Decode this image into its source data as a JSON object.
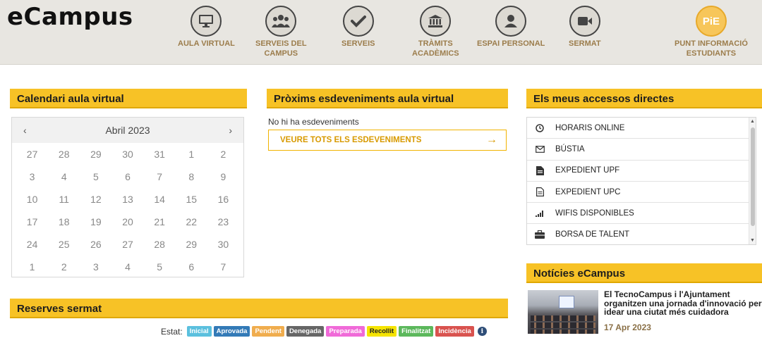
{
  "header": {
    "logo": "eCampus",
    "nav": [
      {
        "label": "AULA VIRTUAL",
        "icon": "monitor-icon"
      },
      {
        "label": "SERVEIS DEL\nCAMPUS",
        "icon": "group-icon"
      },
      {
        "label": "SERVEIS",
        "icon": "check-icon"
      },
      {
        "label": "TRÀMITS\nACADÈMICS",
        "icon": "institution-icon"
      },
      {
        "label": "ESPAI PERSONAL",
        "icon": "user-icon"
      },
      {
        "label": "SERMAT",
        "icon": "video-camera-icon"
      },
      {
        "label": "PUNT INFORMACIÓ\nESTUDIANTS",
        "icon": "pie-logo",
        "badge": "PiE"
      }
    ]
  },
  "calendar": {
    "title": "Calendari aula virtual",
    "month": "Abril 2023",
    "prev": "‹",
    "next": "›",
    "days": [
      "27",
      "28",
      "29",
      "30",
      "31",
      "1",
      "2",
      "3",
      "4",
      "5",
      "6",
      "7",
      "8",
      "9",
      "10",
      "11",
      "12",
      "13",
      "14",
      "15",
      "16",
      "17",
      "18",
      "19",
      "20",
      "21",
      "22",
      "23",
      "24",
      "25",
      "26",
      "27",
      "28",
      "29",
      "30",
      "1",
      "2",
      "3",
      "4",
      "5",
      "6",
      "7"
    ]
  },
  "events": {
    "title": "Pròxims esdeveniments aula virtual",
    "empty": "No hi ha esdeveniments",
    "button": "VEURE TOTS ELS ESDEVENIMENTS",
    "arrow": "→"
  },
  "quick_access": {
    "title": "Els meus accessos directes",
    "items": [
      {
        "label": "HORARIS ONLINE",
        "icon": "clock-icon"
      },
      {
        "label": "BÚSTIA",
        "icon": "envelope-icon"
      },
      {
        "label": "EXPEDIENT UPF",
        "icon": "file-icon"
      },
      {
        "label": "EXPEDIENT UPC",
        "icon": "file-text-icon"
      },
      {
        "label": "WIFIS DISPONIBLES",
        "icon": "signal-icon"
      },
      {
        "label": "BORSA DE TALENT",
        "icon": "briefcase-icon"
      }
    ]
  },
  "news": {
    "title": "Notícies eCampus",
    "headline": "El TecnoCampus i l'Ajuntament organitzen una jornada d'innovació per idear una ciutat més cuidadora",
    "date": "17 Apr 2023"
  },
  "reserves": {
    "title": "Reserves sermat",
    "estat_label": "Estat:",
    "statuses": [
      {
        "label": "Inicial",
        "color": "#5bc0de"
      },
      {
        "label": "Aprovada",
        "color": "#337ab7"
      },
      {
        "label": "Pendent",
        "color": "#f0ad4e"
      },
      {
        "label": "Denegada",
        "color": "#666666"
      },
      {
        "label": "Preparada",
        "color": "#f06ad8"
      },
      {
        "label": "Recollit",
        "color": "#f5e400"
      },
      {
        "label": "Finalitzat",
        "color": "#5cb85c"
      },
      {
        "label": "Incidència",
        "color": "#d9534f"
      }
    ]
  },
  "colors": {
    "accent": "#f7c226",
    "nav_label": "#9c7d4c",
    "link": "#d89a00"
  }
}
